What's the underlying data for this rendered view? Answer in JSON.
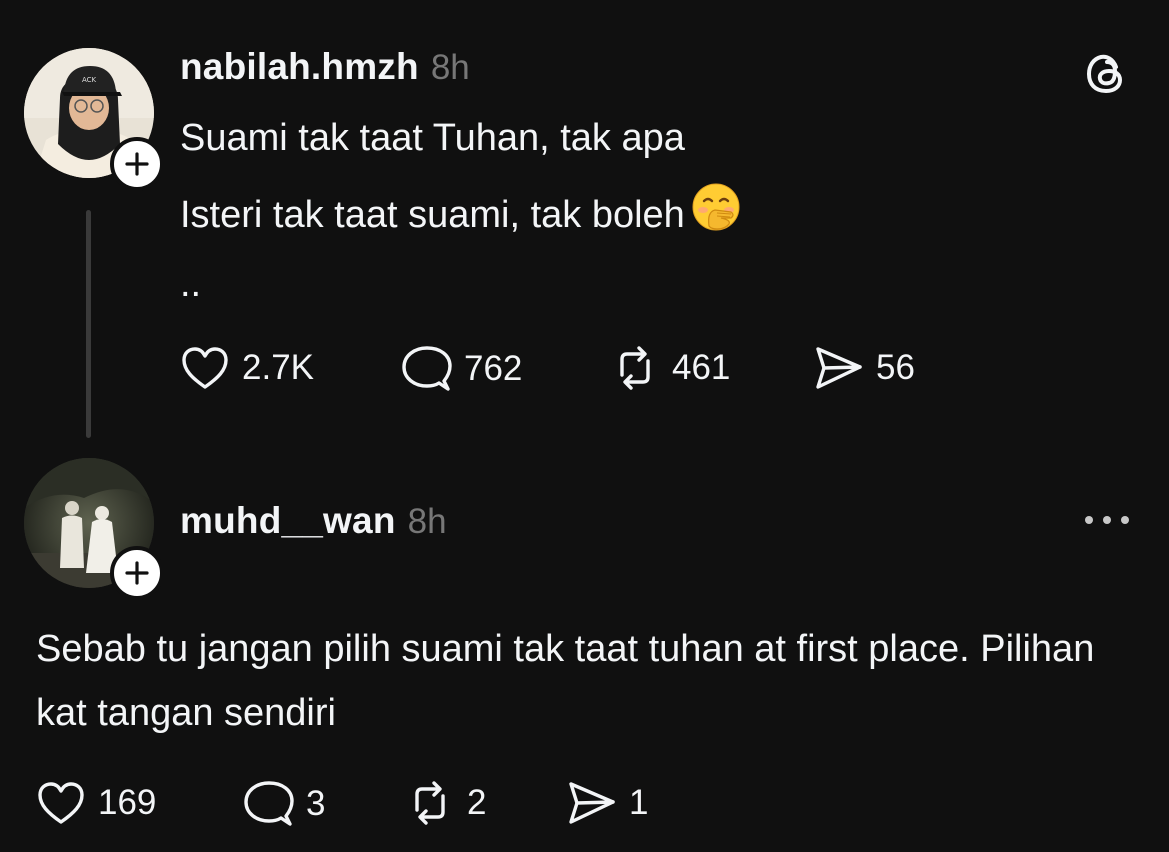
{
  "post": {
    "username": "nabilah.hmzh",
    "time": "8h",
    "lines": [
      "Suami tak taat Tuhan, tak apa",
      "Isteri tak taat suami, tak boleh",
      ".."
    ],
    "emoji": "face-with-hand-over-mouth",
    "actions": {
      "likes": "2.7K",
      "comments": "762",
      "reposts": "461",
      "shares": "56"
    }
  },
  "reply": {
    "username": "muhd__wan",
    "time": "8h",
    "text": "Sebab tu jangan pilih suami tak taat tuhan at first place. Pilihan kat tangan sendiri",
    "actions": {
      "likes": "169",
      "comments": "3",
      "reposts": "2",
      "shares": "1"
    }
  },
  "icons": {
    "app": "threads-logo-icon",
    "more": "more-options-icon",
    "follow": "plus-icon",
    "like": "heart-icon",
    "comment": "comment-bubble-icon",
    "repost": "repost-icon",
    "share": "send-icon"
  },
  "colors": {
    "background": "#101010",
    "text": "#f3f5f7",
    "muted": "#777777",
    "thread_line": "#3a3a3a"
  }
}
